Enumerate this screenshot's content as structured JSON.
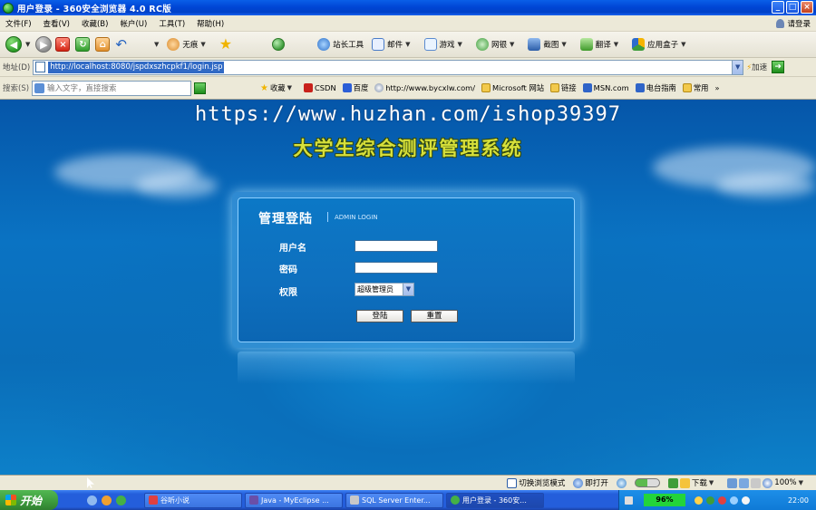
{
  "window": {
    "title": "用户登录 - 360安全浏览器 4.0 RC版",
    "buttons": [
      "_",
      "□",
      "×"
    ]
  },
  "menu": {
    "items": [
      "文件(F)",
      "查看(V)",
      "收藏(B)",
      "帐户(U)",
      "工具(T)",
      "帮助(H)"
    ],
    "login": "请登录"
  },
  "toolbar": {
    "no_trace": "无痕",
    "webmaster_tools": "站长工具",
    "mail": "邮件",
    "games": "游戏",
    "online_banking": "网银",
    "screenshot": "截图",
    "translate": "翻译",
    "app_box": "应用盒子"
  },
  "address": {
    "label": "地址(D)",
    "url": "http://localhost:8080/jspdxszhcpkf1/login.jsp",
    "speed": "加速"
  },
  "searchbar": {
    "label": "搜索(S)",
    "placeholder": "输入文字，直接搜索",
    "favorites_label": "收藏",
    "links": [
      "CSDN",
      "百度",
      "http://www.bycxlw.com/",
      "Microsoft 网站",
      "链接",
      "MSN.com",
      "电台指南",
      "常用"
    ],
    "more": "»"
  },
  "page": {
    "watermark": "https://www.huzhan.com/ishop39397",
    "system_title": "大学生综合测评管理系统",
    "panel_title": "管理登陆",
    "panel_subtitle": "ADMIN LOGIN",
    "username_label": "用户名",
    "password_label": "密码",
    "role_label": "权限",
    "role_selected": "超级管理员",
    "login_button": "登陆",
    "reset_button": "重置"
  },
  "status": {
    "switch_mode": "切换浏览模式",
    "open_now": "即打开",
    "download": "下载",
    "zoom": "100%"
  },
  "taskbar": {
    "start": "开始",
    "tasks": [
      "谷听小说",
      "Java - MyEclipse ...",
      "SQL Server Enter...",
      "用户登录 - 360安..."
    ],
    "battery": "96%",
    "clock": "22:00"
  }
}
